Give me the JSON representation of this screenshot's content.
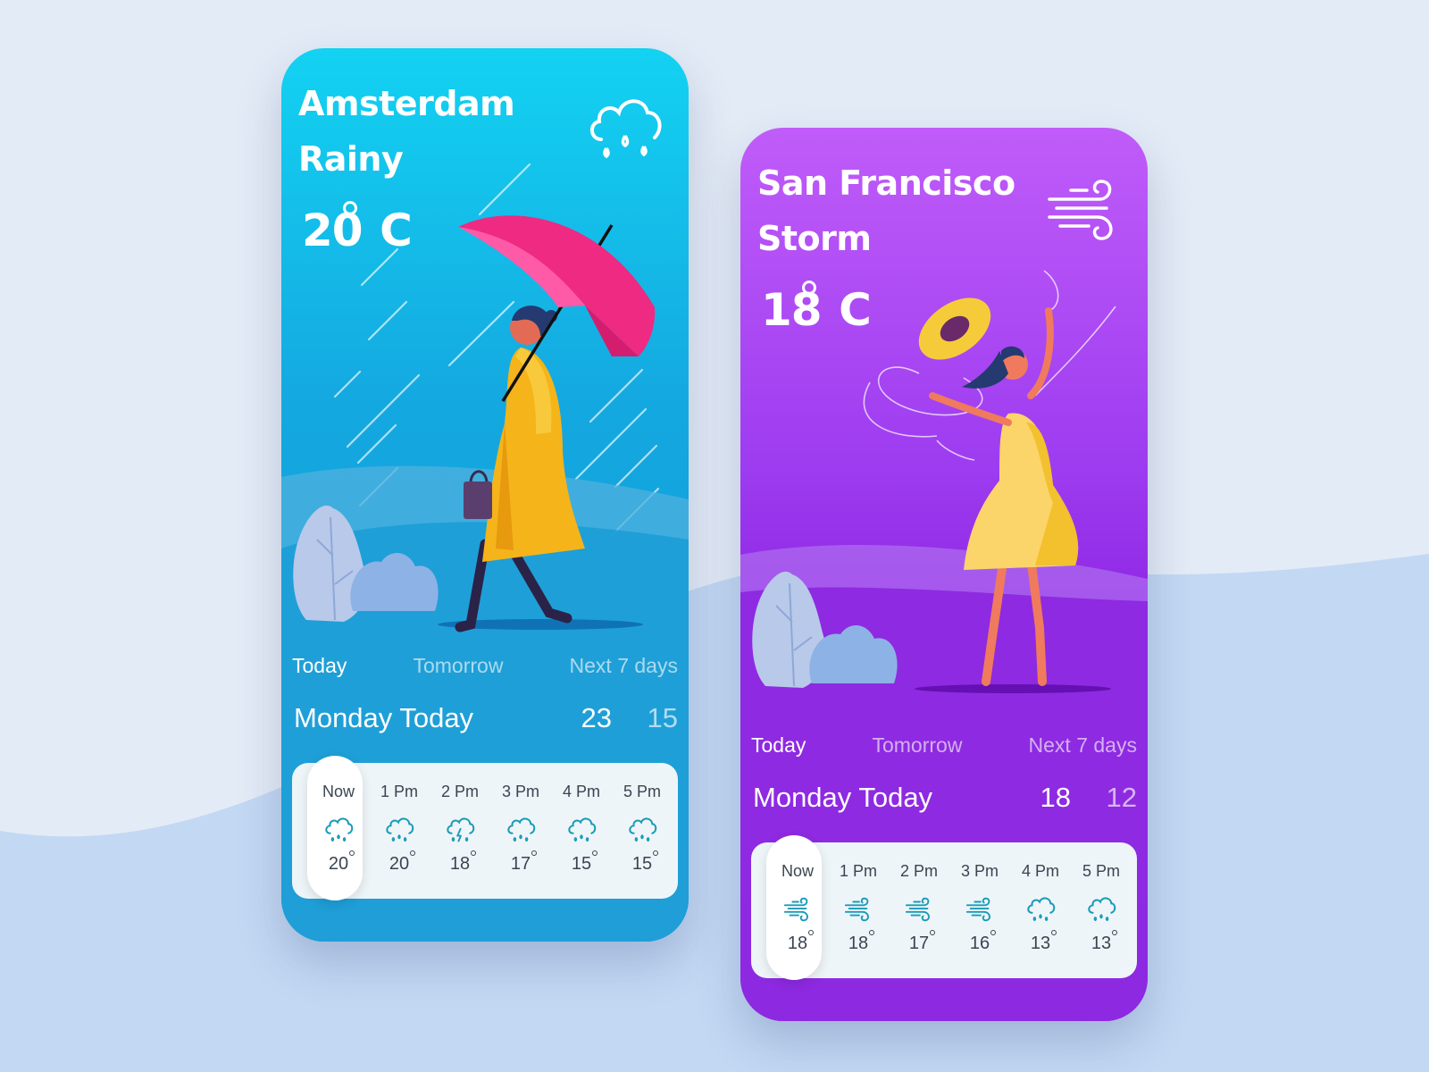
{
  "colors": {
    "page_bg": "#e3ebf6",
    "wave": "#c3d8f3",
    "blue_card": "#14a8e0",
    "purple_card": "#8a20e0",
    "hourly_panel": "#eef5f8",
    "icon_teal": "#1a9bb8"
  },
  "cards": [
    {
      "city": "Amsterdam",
      "condition": "Rainy",
      "temp": "20",
      "unit": "C",
      "icon": "rain-cloud-icon",
      "tabs": [
        "Today",
        "Tomorrow",
        "Next 7 days"
      ],
      "day_label": "Monday Today",
      "high": "23",
      "low": "15",
      "hourly": [
        {
          "time": "Now",
          "icon": "rain-cloud-icon",
          "temp": "20"
        },
        {
          "time": "1 Pm",
          "icon": "rain-cloud-icon",
          "temp": "20"
        },
        {
          "time": "2 Pm",
          "icon": "thunder-cloud-icon",
          "temp": "18"
        },
        {
          "time": "3 Pm",
          "icon": "rain-cloud-icon",
          "temp": "17"
        },
        {
          "time": "4 Pm",
          "icon": "rain-cloud-icon",
          "temp": "15"
        },
        {
          "time": "5 Pm",
          "icon": "rain-cloud-icon",
          "temp": "15"
        }
      ]
    },
    {
      "city": "San Francisco",
      "condition": "Storm",
      "temp": "18",
      "unit": "C",
      "icon": "wind-icon",
      "tabs": [
        "Today",
        "Tomorrow",
        "Next 7 days"
      ],
      "day_label": "Monday Today",
      "high": "18",
      "low": "12",
      "hourly": [
        {
          "time": "Now",
          "icon": "wind-icon",
          "temp": "18"
        },
        {
          "time": "1 Pm",
          "icon": "wind-icon",
          "temp": "18"
        },
        {
          "time": "2 Pm",
          "icon": "wind-icon",
          "temp": "17"
        },
        {
          "time": "3 Pm",
          "icon": "wind-icon",
          "temp": "16"
        },
        {
          "time": "4 Pm",
          "icon": "rain-cloud-icon",
          "temp": "13"
        },
        {
          "time": "5 Pm",
          "icon": "rain-cloud-icon",
          "temp": "13"
        }
      ]
    }
  ]
}
